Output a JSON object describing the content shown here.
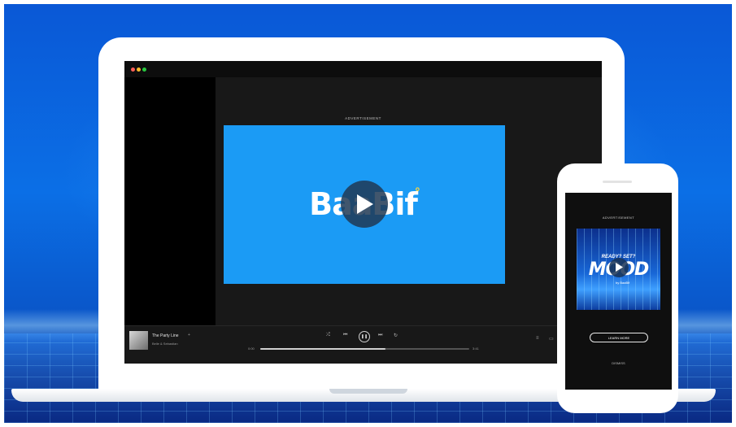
{
  "laptop": {
    "ad_label": "ADVERTISEMENT",
    "brand_main": "BaaBif",
    "brand_dot": "°",
    "player": {
      "track_title": "The Party Line",
      "artist": "Belle & Sebastian",
      "elapsed": "0:00",
      "duration": "3:41",
      "progress": 0.6
    }
  },
  "phone": {
    "ad_label": "ADVERTISEMENT",
    "card_top_text": "READY? SET?",
    "card_main_text": "MOOD",
    "card_by_text": "by BaaBif",
    "learn_more": "LEARN MORE",
    "foot_text": "DISMISS"
  },
  "colors": {
    "background": "#0b6fe6",
    "ad_card": "#1b9bf5",
    "player_bg": "#181818",
    "accent_yellow": "#ffd43b"
  }
}
